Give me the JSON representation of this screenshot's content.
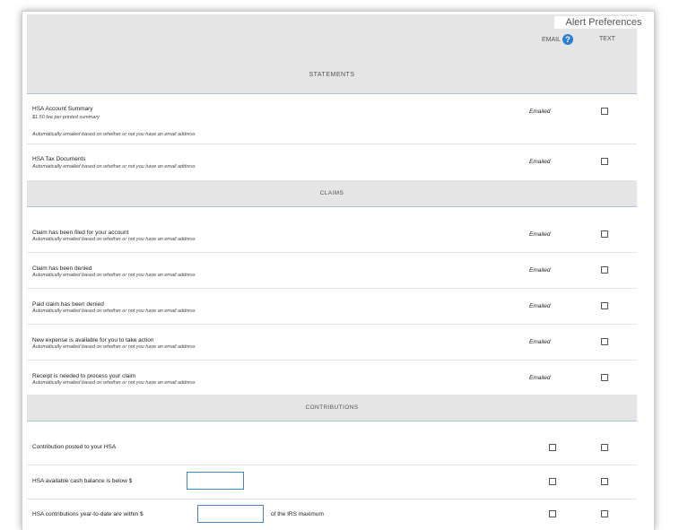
{
  "header": {
    "title": "Alert Preferences",
    "email_label": "EMAIL",
    "text_label": "TEXT",
    "help_glyph": "?"
  },
  "sections": [
    {
      "title": "STATEMENTS",
      "rows": [
        {
          "title": "HSA Account Summary",
          "note": "$1.50 fee per printed summary",
          "sub": "Automatically emailed based on whether or not you have an email address",
          "email_status": "Emailed"
        },
        {
          "title": "HSA Tax Documents",
          "sub": "Automatically emailed based on whether or not you have an email address",
          "email_status": "Emailed"
        }
      ]
    },
    {
      "title": "CLAIMS",
      "rows": [
        {
          "title": "Claim has been filed for your account",
          "sub": "Automatically emailed based on whether or not you have an email address",
          "email_status": "Emailed"
        },
        {
          "title": "Claim has been denied",
          "sub": "Automatically emailed based on whether or not you have an email address",
          "email_status": "Emailed"
        },
        {
          "title": "Paid claim has been denied",
          "sub": "Automatically emailed based on whether or not you have an email address",
          "email_status": "Emailed"
        },
        {
          "title": "New expense is available for you to take action",
          "sub": "Automatically emailed based on whether or not you have an email address",
          "email_status": "Emailed"
        },
        {
          "title": "Receipt is needed to process your claim",
          "sub": "Automatically emailed based on whether or not you have an email address",
          "email_status": "Emailed"
        }
      ]
    },
    {
      "title": "CONTRIBUTIONS",
      "rows": [
        {
          "title": "Contribution posted to your HSA"
        },
        {
          "title": "HSA available cash balance is below $",
          "input_value": ""
        },
        {
          "title": "HSA contributions year-to-date are within $",
          "input_value": "",
          "suffix": "of the IRS maximum"
        }
      ]
    }
  ]
}
